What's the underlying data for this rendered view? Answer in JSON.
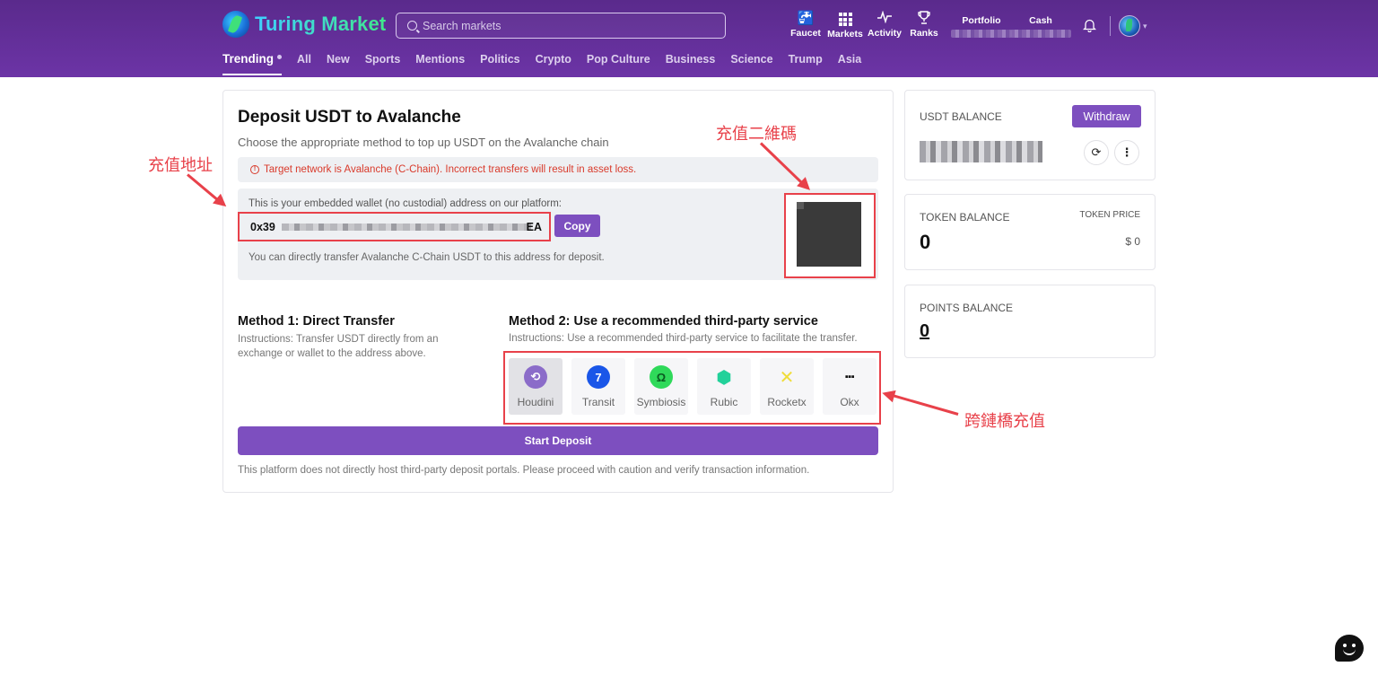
{
  "header": {
    "logo_text": "Turing Market",
    "search_placeholder": "Search markets",
    "nav": [
      {
        "label": "Faucet",
        "icon": "faucet-icon"
      },
      {
        "label": "Markets",
        "icon": "grid-icon"
      },
      {
        "label": "Activity",
        "icon": "activity-icon"
      },
      {
        "label": "Ranks",
        "icon": "trophy-icon"
      }
    ],
    "portfolio_label": "Portfolio",
    "cash_label": "Cash"
  },
  "tabs": [
    "Trending",
    "All",
    "New",
    "Sports",
    "Mentions",
    "Politics",
    "Crypto",
    "Pop Culture",
    "Business",
    "Science",
    "Trump",
    "Asia"
  ],
  "deposit": {
    "title": "Deposit USDT to Avalanche",
    "subtitle": "Choose the appropriate method to top up USDT on the Avalanche chain",
    "alert": "Target network is Avalanche (C-Chain). Incorrect transfers will result in asset loss.",
    "wallet_label": "This is your embedded wallet (no custodial) address on our platform:",
    "address_start": "0x39",
    "address_end": "EA",
    "copy_label": "Copy",
    "wallet_note": "You can directly transfer Avalanche C-Chain USDT to this address for deposit.",
    "method1_title": "Method 1: Direct Transfer",
    "method1_desc": "Instructions: Transfer USDT directly from an exchange or wallet to the address above.",
    "method2_title": "Method 2: Use a recommended third-party service",
    "method2_desc": "Instructions: Use a recommended third-party service to facilitate the transfer.",
    "services": [
      {
        "label": "Houdini",
        "color": "#8b6cc9"
      },
      {
        "label": "Transit",
        "color": "#1a56e8"
      },
      {
        "label": "Symbiosis",
        "color": "#2fd95a"
      },
      {
        "label": "Rubic",
        "color": "#22d19a"
      },
      {
        "label": "Rocketx",
        "color": "#f5e84a"
      },
      {
        "label": "Okx",
        "color": "#111111"
      }
    ],
    "start_label": "Start Deposit",
    "disclaimer": "This platform does not directly host third-party deposit portals. Please proceed with caution and verify transaction information."
  },
  "side": {
    "usdt_label": "USDT BALANCE",
    "withdraw_label": "Withdraw",
    "token_label": "TOKEN BALANCE",
    "token_value": "0",
    "token_price_label": "TOKEN PRICE",
    "token_price_value": "$ 0",
    "points_label": "POINTS BALANCE",
    "points_value": "0"
  },
  "annotations": {
    "address": "充值地址",
    "qr": "充值二維碼",
    "bridge": "跨鏈橋充值"
  },
  "colors": {
    "accent": "#7d4fbf",
    "header": "#6a33a3",
    "annotation": "#e8414a"
  }
}
